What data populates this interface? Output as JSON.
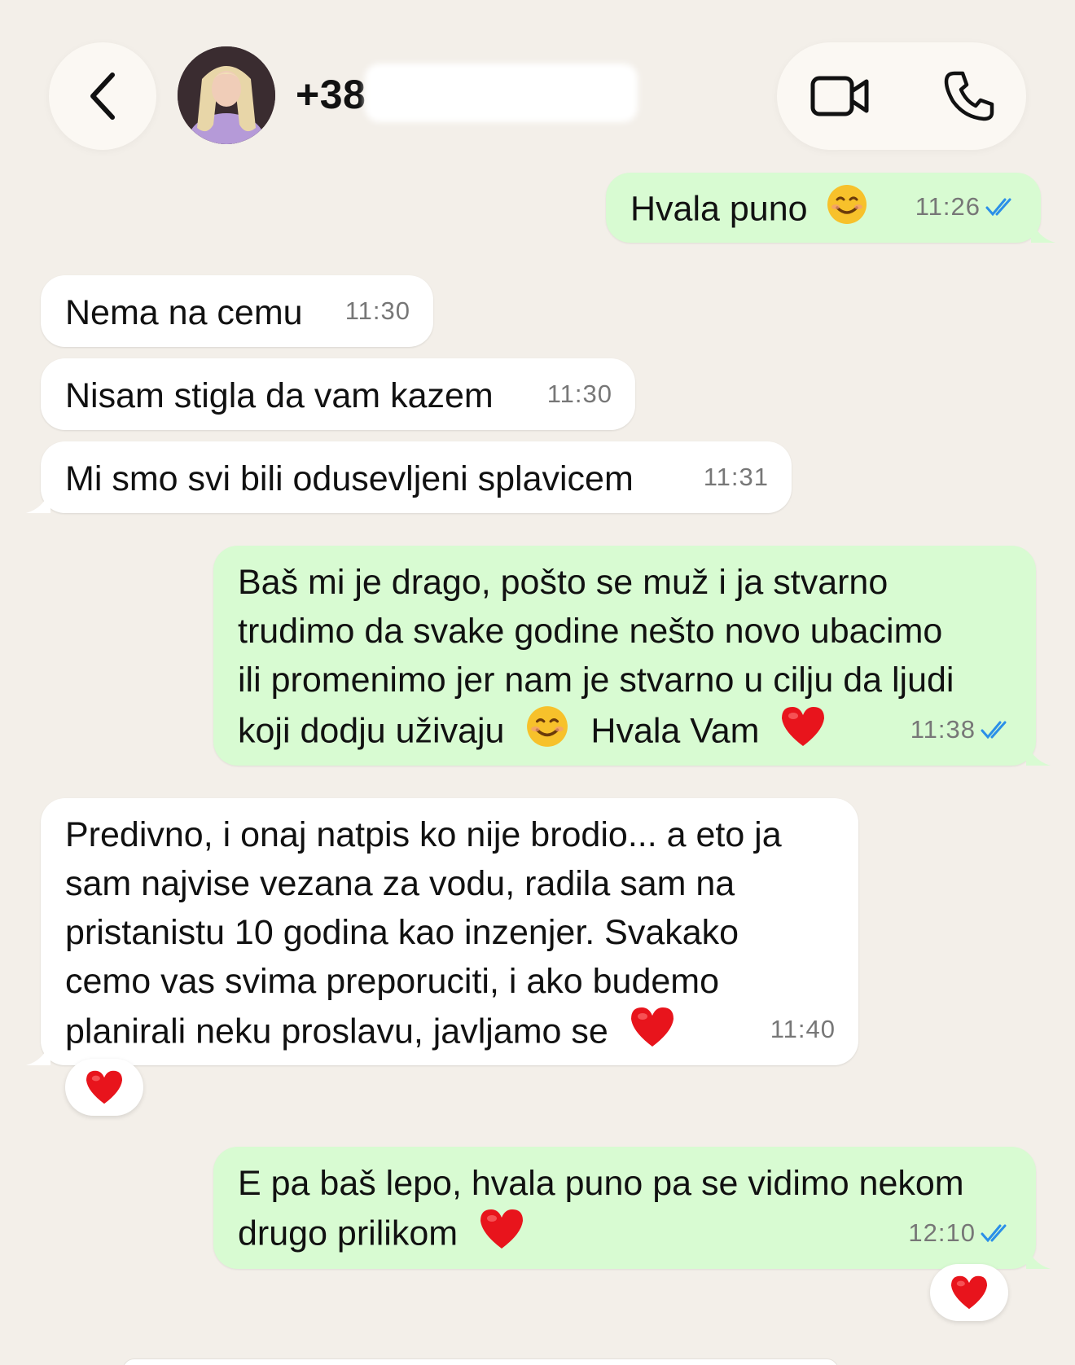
{
  "header": {
    "contact_name": "+38",
    "back_icon": "chevron-left-icon",
    "video_icon": "video-camera-icon",
    "phone_icon": "phone-icon"
  },
  "messages": [
    {
      "direction": "out",
      "text": "Hvala puno",
      "time": "11:26",
      "status": "read"
    },
    {
      "direction": "in",
      "text": "Nema na cemu",
      "time": "11:30"
    },
    {
      "direction": "in",
      "text": "Nisam stigla da vam kazem",
      "time": "11:30"
    },
    {
      "direction": "in",
      "text": "Mi smo svi bili odusevljeni splavicem",
      "time": "11:31"
    },
    {
      "direction": "out",
      "lines": [
        "Baš mi je drago, pošto se muž i ja stvarno",
        "trudimo da svake godine nešto novo ubacimo",
        "ili promenimo jer nam je stvarno u cilju da ljudi",
        "koji dodju uživaju"
      ],
      "tail_text": "Hvala Vam",
      "time": "11:38",
      "status": "read"
    },
    {
      "direction": "in",
      "lines": [
        "Predivno, i onaj natpis ko nije brodio... a eto ja",
        "sam najvise vezana za vodu, radila sam na",
        "pristanistu 10 godina kao inzenjer. Svakako",
        "cemo vas svima preporuciti, i ako budemo",
        "planirali neku proslavu, javljamo se"
      ],
      "time": "11:40",
      "reaction": "red-heart"
    },
    {
      "direction": "out",
      "lines": [
        "E pa baš lepo, hvala puno pa se vidimo nekom",
        "drugo prilikom"
      ],
      "time": "12:10",
      "status": "read",
      "reaction": "red-heart"
    }
  ],
  "colors": {
    "background": "#f3efe9",
    "incoming_bubble": "#ffffff",
    "outgoing_bubble": "#d8fbd2",
    "read_ticks": "#2b8fe8",
    "heart": "#e8141c"
  }
}
